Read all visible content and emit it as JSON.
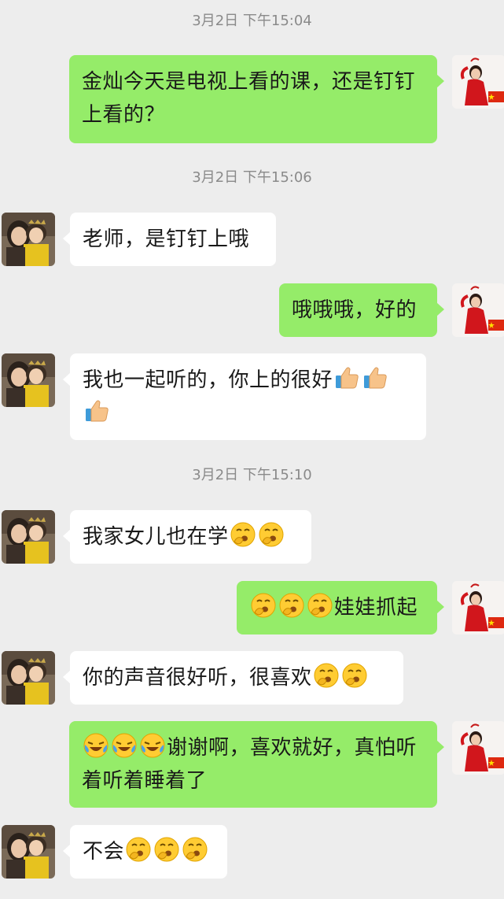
{
  "chat": {
    "timestamps": [
      "3月2日 下午15:04",
      "3月2日 下午15:06",
      "3月2日 下午15:10"
    ],
    "messages": [
      {
        "side": "out",
        "text": "金灿今天是电视上看的课，还是钉钉上看的？",
        "emoji": []
      },
      {
        "side": "in",
        "text": "老师，是钉钉上哦",
        "emoji": []
      },
      {
        "side": "out",
        "text": "哦哦哦，好的",
        "emoji": []
      },
      {
        "side": "in",
        "text": "我也一起听的，你上的很好",
        "emoji": [
          "thumbs-up-icon",
          "thumbs-up-icon",
          "thumbs-up-icon"
        ]
      },
      {
        "side": "in",
        "text": "我家女儿也在学",
        "emoji": [
          "yawn-face-icon",
          "yawn-face-icon"
        ]
      },
      {
        "side": "out",
        "text": "娃娃抓起",
        "emoji": [
          "yawn-face-icon",
          "yawn-face-icon",
          "yawn-face-icon"
        ]
      },
      {
        "side": "in",
        "text": "你的声音很好听，很喜欢",
        "emoji": [
          "yawn-face-icon",
          "yawn-face-icon"
        ]
      },
      {
        "side": "out",
        "text": "谢谢啊，喜欢就好，真怕听着听着睡着了",
        "emoji": [
          "crying-laughing-icon",
          "crying-laughing-icon",
          "crying-laughing-icon"
        ]
      },
      {
        "side": "in",
        "text": "不会",
        "emoji": [
          "yawn-face-icon",
          "yawn-face-icon",
          "yawn-face-icon"
        ]
      }
    ],
    "colors": {
      "background": "#ededed",
      "incoming": "#ffffff",
      "outgoing": "#95ec69",
      "timestamp": "#8a8a8a"
    }
  }
}
